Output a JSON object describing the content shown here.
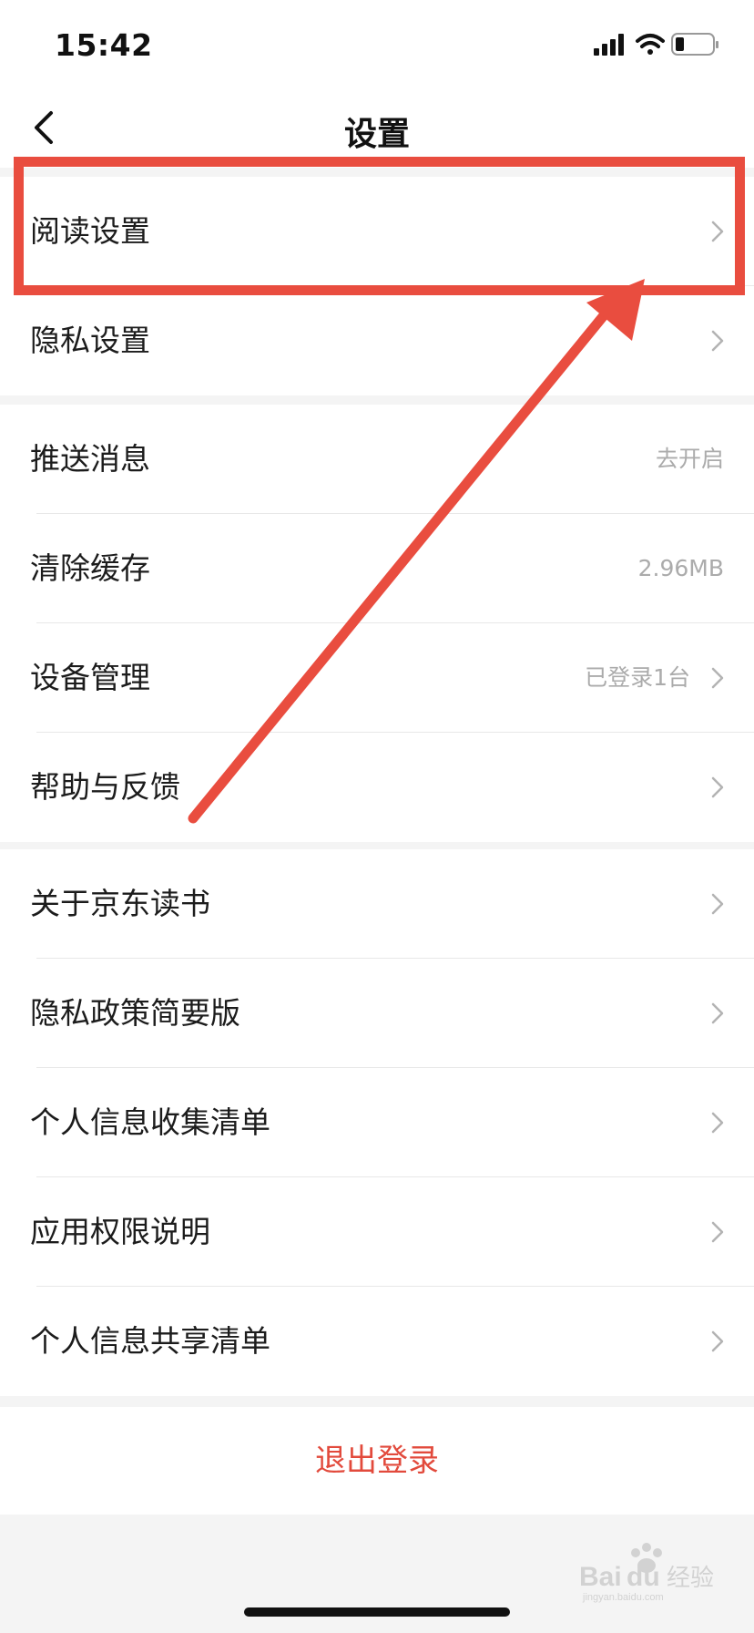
{
  "status_bar": {
    "time": "15:42",
    "icons": [
      "signal-icon",
      "wifi-icon",
      "battery-icon"
    ]
  },
  "nav": {
    "title": "设置",
    "back_icon": "chevron-left-icon"
  },
  "groups": [
    {
      "items": [
        {
          "label": "阅读设置",
          "value": "",
          "chevron": true
        },
        {
          "label": "隐私设置",
          "value": "",
          "chevron": true
        }
      ]
    },
    {
      "items": [
        {
          "label": "推送消息",
          "value": "去开启",
          "chevron": false
        },
        {
          "label": "清除缓存",
          "value": "2.96MB",
          "chevron": false
        },
        {
          "label": "设备管理",
          "value": "已登录1台",
          "chevron": true
        },
        {
          "label": "帮助与反馈",
          "value": "",
          "chevron": true
        }
      ]
    },
    {
      "items": [
        {
          "label": "关于京东读书",
          "value": "",
          "chevron": true
        },
        {
          "label": "隐私政策简要版",
          "value": "",
          "chevron": true
        },
        {
          "label": "个人信息收集清单",
          "value": "",
          "chevron": true
        },
        {
          "label": "应用权限说明",
          "value": "",
          "chevron": true
        },
        {
          "label": "个人信息共享清单",
          "value": "",
          "chevron": true
        }
      ]
    }
  ],
  "logout": {
    "label": "退出登录"
  },
  "watermark": {
    "text": "Baidu 经验",
    "subtext": "jingyan.baidu.com"
  },
  "colors": {
    "accent_red": "#e24a3c",
    "annotation_red": "#e94d3f",
    "secondary_text": "#ababab",
    "background": "#f4f4f4"
  }
}
